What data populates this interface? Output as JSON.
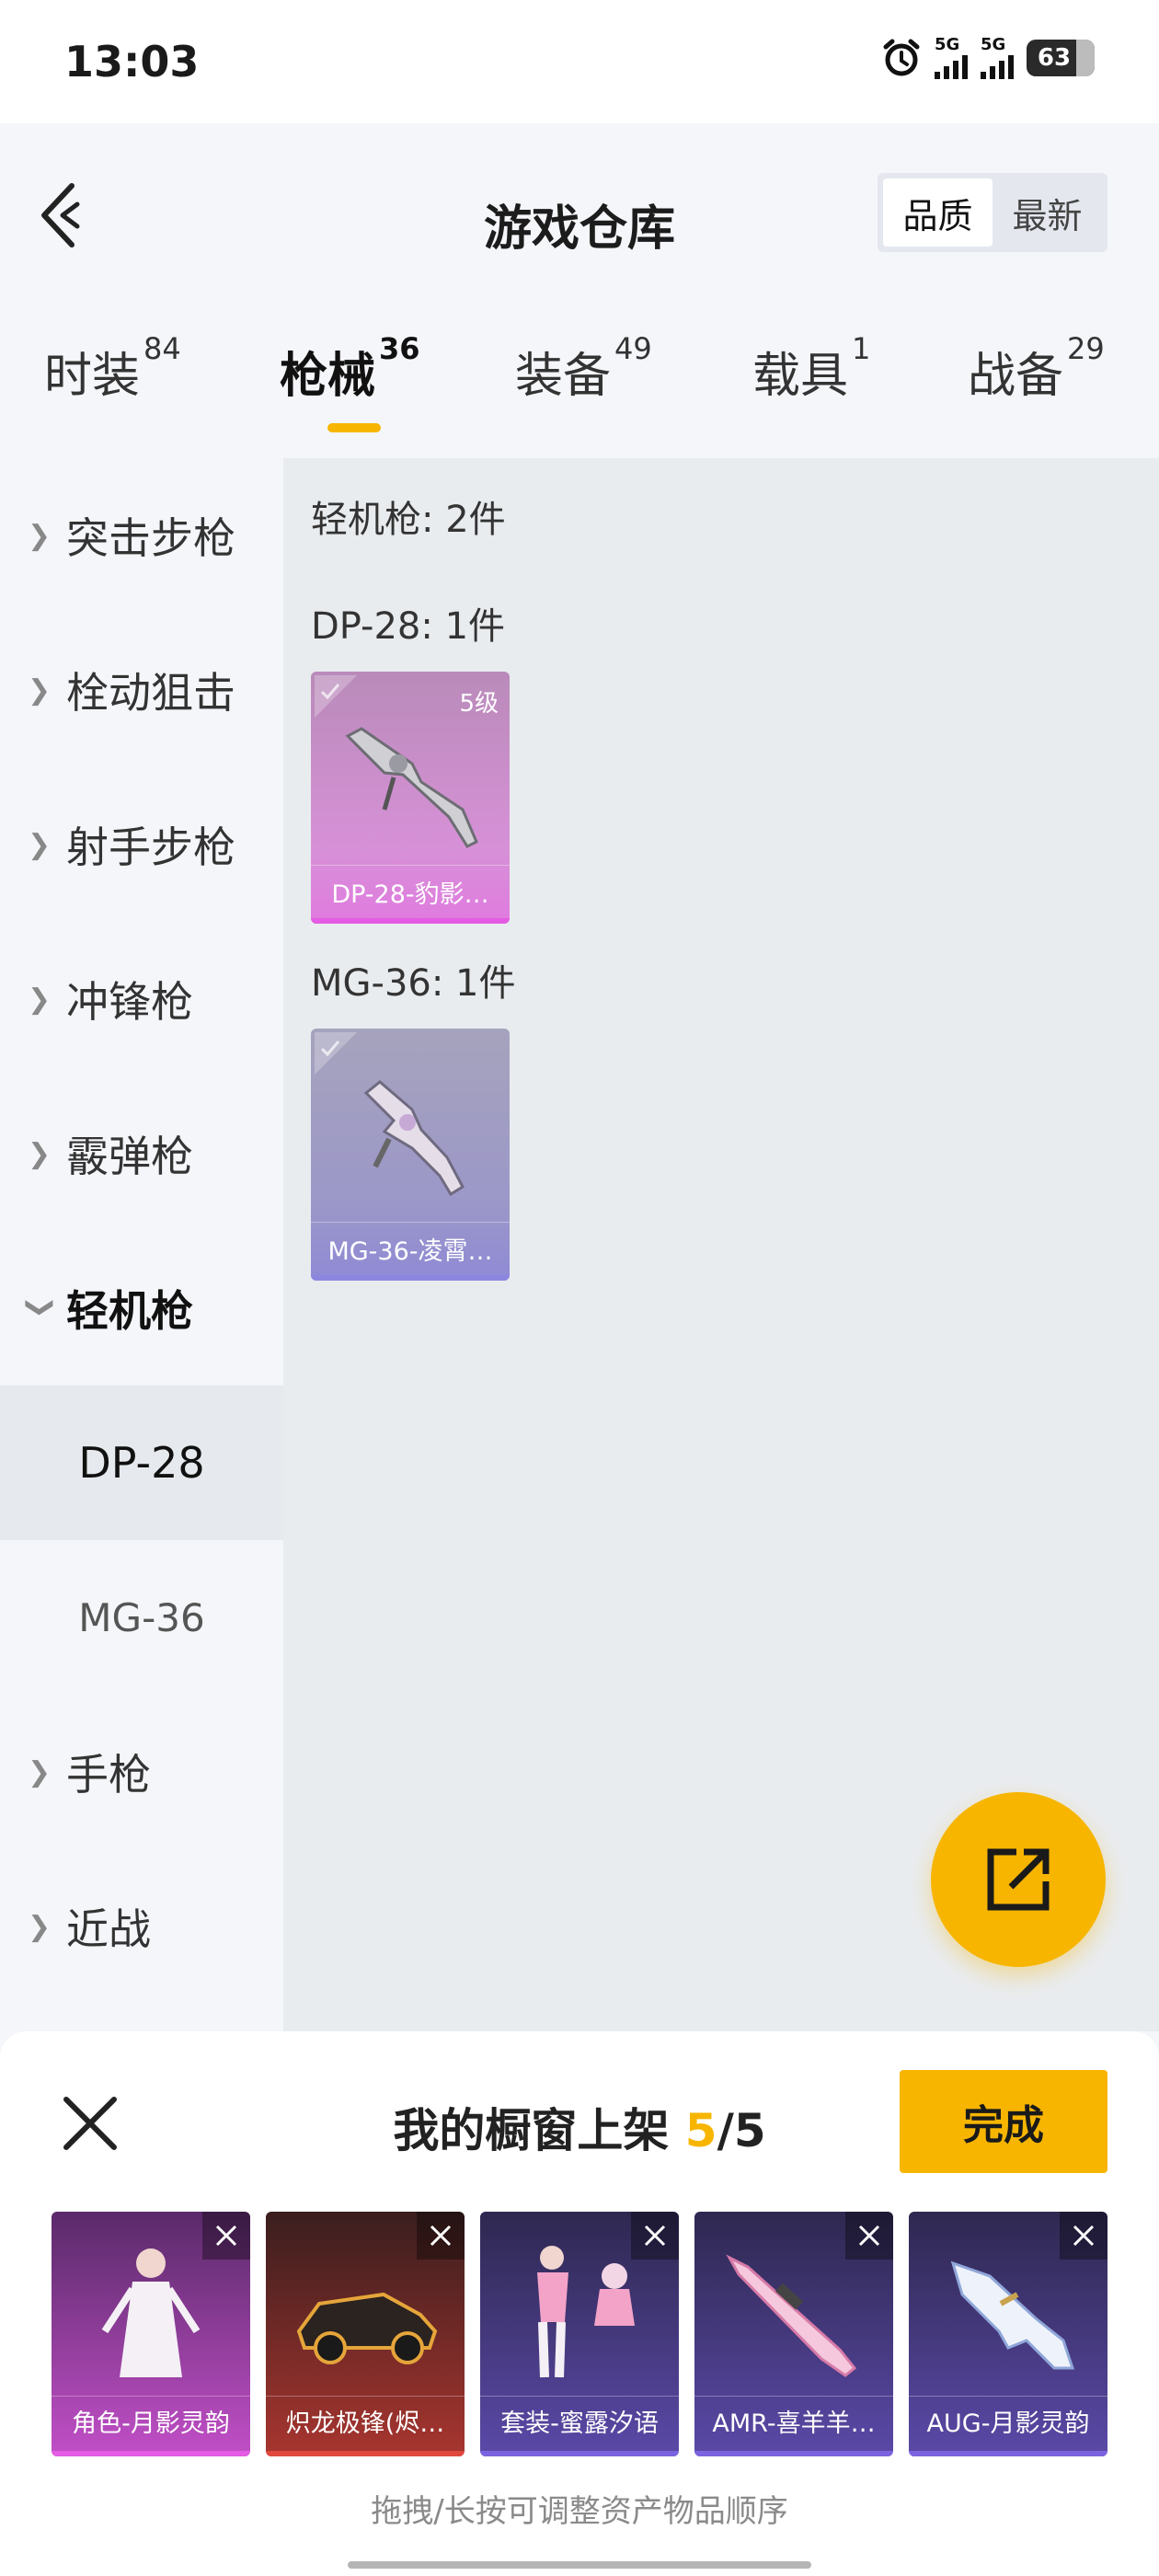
{
  "status_bar": {
    "time": "13:03",
    "sim1_label": "5G",
    "sim2_label": "5G",
    "battery": "63"
  },
  "header": {
    "title": "游戏仓库",
    "sort_options": [
      "品质",
      "最新"
    ],
    "sort_selected": "品质"
  },
  "tabs": [
    {
      "label": "时装",
      "count": "84",
      "active": false
    },
    {
      "label": "枪械",
      "count": "36",
      "active": true
    },
    {
      "label": "装备",
      "count": "49",
      "active": false
    },
    {
      "label": "载具",
      "count": "1",
      "active": false
    },
    {
      "label": "战备",
      "count": "29",
      "active": false
    }
  ],
  "sidebar": {
    "categories": [
      {
        "label": "突击步枪",
        "expanded": false
      },
      {
        "label": "栓动狙击",
        "expanded": false
      },
      {
        "label": "射手步枪",
        "expanded": false
      },
      {
        "label": "冲锋枪",
        "expanded": false
      },
      {
        "label": "霰弹枪",
        "expanded": false
      },
      {
        "label": "轻机枪",
        "expanded": true
      },
      {
        "label": "手枪",
        "expanded": false
      },
      {
        "label": "近战",
        "expanded": false
      }
    ],
    "subcategories": [
      {
        "label": "DP-28",
        "active": true
      },
      {
        "label": "MG-36",
        "active": false
      }
    ]
  },
  "content": {
    "summary": "轻机枪: 2件",
    "groups": [
      {
        "heading": "DP-28: 1件",
        "item": {
          "name": "DP-28-豹影…",
          "level": "5级",
          "rarity_color": "#d98ad9",
          "icon": "lmg-weapon-icon"
        }
      },
      {
        "heading": "MG-36: 1件",
        "item": {
          "name": "MG-36-凌霄…",
          "level": "",
          "rarity_color": "#9a96cf",
          "icon": "lmg-weapon-icon"
        }
      }
    ]
  },
  "share_button": {
    "icon": "share-export-icon",
    "color": "#f7b500"
  },
  "showcase": {
    "title_prefix": "我的橱窗上架",
    "current": "5",
    "separator": "/",
    "max": "5",
    "done_label": "完成",
    "hint": "拖拽/长按可调整资产物品顺序",
    "items": [
      {
        "name": "角色-月影灵韵",
        "color_top": "#5a2a6a",
        "color_bottom": "#c14fc7",
        "bar": "#e35ce3",
        "icon": "character-outfit-icon"
      },
      {
        "name": "炽龙极锋(烬…",
        "color_top": "#3a1e1e",
        "color_bottom": "#a8352f",
        "bar": "#e0483e",
        "icon": "sports-car-icon"
      },
      {
        "name": "套装-蜜露汐语",
        "color_top": "#2e2850",
        "color_bottom": "#5b49a8",
        "bar": "#7b63e0",
        "icon": "outfit-set-icon"
      },
      {
        "name": "AMR-喜羊羊…",
        "color_top": "#2e2850",
        "color_bottom": "#5b49a8",
        "bar": "#7b63e0",
        "icon": "sniper-rifle-icon"
      },
      {
        "name": "AUG-月影灵韵",
        "color_top": "#2e2850",
        "color_bottom": "#5b49a8",
        "bar": "#7b63e0",
        "icon": "assault-rifle-icon"
      }
    ]
  }
}
